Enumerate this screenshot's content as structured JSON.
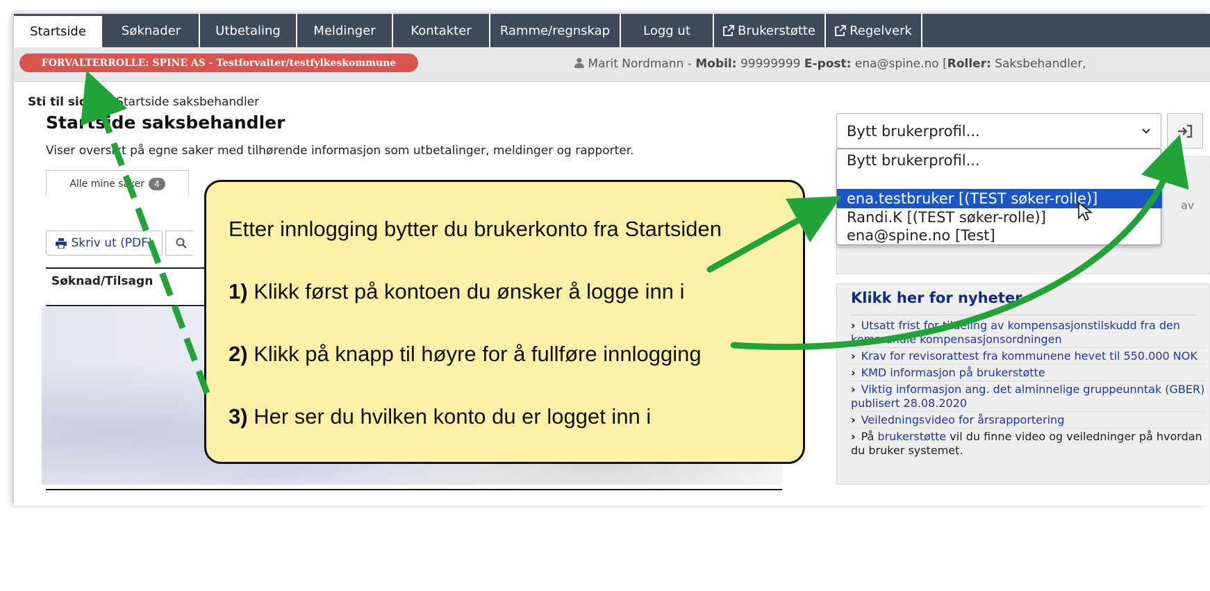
{
  "nav": {
    "tabs": [
      {
        "label": "Startside",
        "active": true
      },
      {
        "label": "Søknader"
      },
      {
        "label": "Utbetaling"
      },
      {
        "label": "Meldinger"
      },
      {
        "label": "Kontakter"
      },
      {
        "label": "Ramme/regnskap"
      },
      {
        "label": "Logg ut"
      },
      {
        "label": "Brukerstøtte",
        "external": true
      },
      {
        "label": "Regelverk",
        "external": true
      }
    ]
  },
  "rolebar": {
    "role_badge": "FORVALTERROLLE: SPINE AS - Testforvalter/testfylkeskommune",
    "user_name": "Marit Nordmann - ",
    "mobile_label": "Mobil:",
    "mobile_value": " 99999999 ",
    "email_label": "E-post:",
    "email_value": " ena@spine.no [",
    "roles_label": "Roller:",
    "roles_value": " Saksbehandler,"
  },
  "breadcrumb": {
    "root": "Sti til side",
    "separator": "/",
    "current": "Startside saksbehandler"
  },
  "main": {
    "title": "Startside saksbehandler",
    "subtitle": "Viser oversikt på egne saker med tilhørende informasjon som utbetalinger, meldinger og rapporter.",
    "tab_all_label": "Alle mine saker",
    "tab_all_count": "4",
    "print_button": "Skriv ut (PDF)",
    "column_header": "Søknad/Tilsagn"
  },
  "profile_switch": {
    "selected": "Bytt brukerprofil...",
    "options": [
      "Bytt brukerprofil...",
      "",
      "ena.testbruker [(TEST søker-rolle)]",
      "Randi.K [(TEST søker-rolle)]",
      "ena@spine.no [Test]"
    ],
    "highlighted_index": 2,
    "panel_tail_text": "av"
  },
  "news": {
    "title": "Klikk her for nyheter",
    "items": [
      "Utsatt frist for tildeling av kompensasjonstilskudd fra den kommunale kompensasjonsordningen",
      "Krav for revisorattest fra kommunene hevet til 550.000 NOK",
      "KMD informasjon på brukerstøtte",
      "Viktig informasjon ang. det alminnelige gruppeunntak (GBER) publisert 28.08.2020",
      "Veiledningsvideo for årsrapportering"
    ],
    "footer_prefix": "På ",
    "footer_link": "brukerstøtte",
    "footer_suffix": " vil du finne video og veiledninger på hvordan du bruker systemet."
  },
  "callout": {
    "heading": "Etter innlogging bytter du brukerkonto fra Startsiden",
    "step1_num": "1)",
    "step1_text": " Klikk først på kontoen du ønsker å logge inn i",
    "step2_num": "2)",
    "step2_text": " Klikk på knapp til høyre for å fullføre innlogging",
    "step3_num": "3)",
    "step3_text": " Her ser du hvilken konto du er logget inn i"
  },
  "colors": {
    "nav_bg": "#3c4a5a",
    "role_badge": "#d9534f",
    "callout_bg": "#fcf1a6",
    "arrow_green": "#22a33a",
    "highlight_blue": "#1a56c8",
    "news_title": "#0c2c86"
  },
  "icons": {
    "external_link": "external-link-icon",
    "user": "user-icon",
    "print": "print-icon",
    "search": "search-icon",
    "login": "sign-in-icon",
    "chevron": "chevron-down-icon"
  }
}
